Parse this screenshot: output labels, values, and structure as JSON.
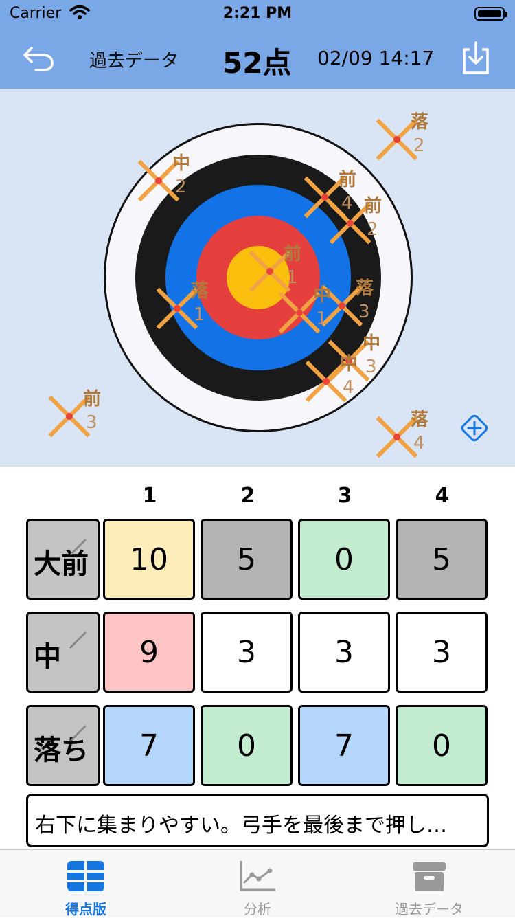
{
  "status_bar": {
    "carrier": "Carrier",
    "time": "2:21 PM"
  },
  "nav": {
    "label": "過去データ",
    "score": "52点",
    "datetime": "02/09 14:17"
  },
  "target": {
    "marks": [
      {
        "label": "落",
        "num": "2"
      },
      {
        "label": "中",
        "num": "2"
      },
      {
        "label": "前",
        "num": "4"
      },
      {
        "label": "前",
        "num": "2"
      },
      {
        "label": "前",
        "num": "1"
      },
      {
        "label": "落",
        "num": "3"
      },
      {
        "label": "中",
        "num": "1"
      },
      {
        "label": "落",
        "num": "1"
      },
      {
        "label": "中",
        "num": "3"
      },
      {
        "label": "中",
        "num": "4"
      },
      {
        "label": "前",
        "num": "3"
      },
      {
        "label": "落",
        "num": "4"
      }
    ]
  },
  "grid": {
    "columns": [
      "1",
      "2",
      "3",
      "4"
    ],
    "rows": [
      {
        "label": "大前",
        "values": [
          "10",
          "5",
          "0",
          "5"
        ]
      },
      {
        "label": "中",
        "values": [
          "9",
          "3",
          "3",
          "3"
        ]
      },
      {
        "label": "落ち",
        "values": [
          "7",
          "0",
          "7",
          "0"
        ]
      }
    ]
  },
  "memo": "右下に集まりやすい。弓手を最後まで押し…",
  "tabs": [
    {
      "label": "得点版"
    },
    {
      "label": "分析"
    },
    {
      "label": "過去データ"
    }
  ],
  "colors": {
    "header": "#7aa7e6",
    "target_bg": "#d9e4f5",
    "accent": "#1677e0",
    "cell_yellow": "#fdedb8",
    "cell_gray": "#b3b3b3",
    "cell_green": "#c4ecd0",
    "cell_pink": "#fdc4c4",
    "cell_blue": "#b4d7fb"
  }
}
